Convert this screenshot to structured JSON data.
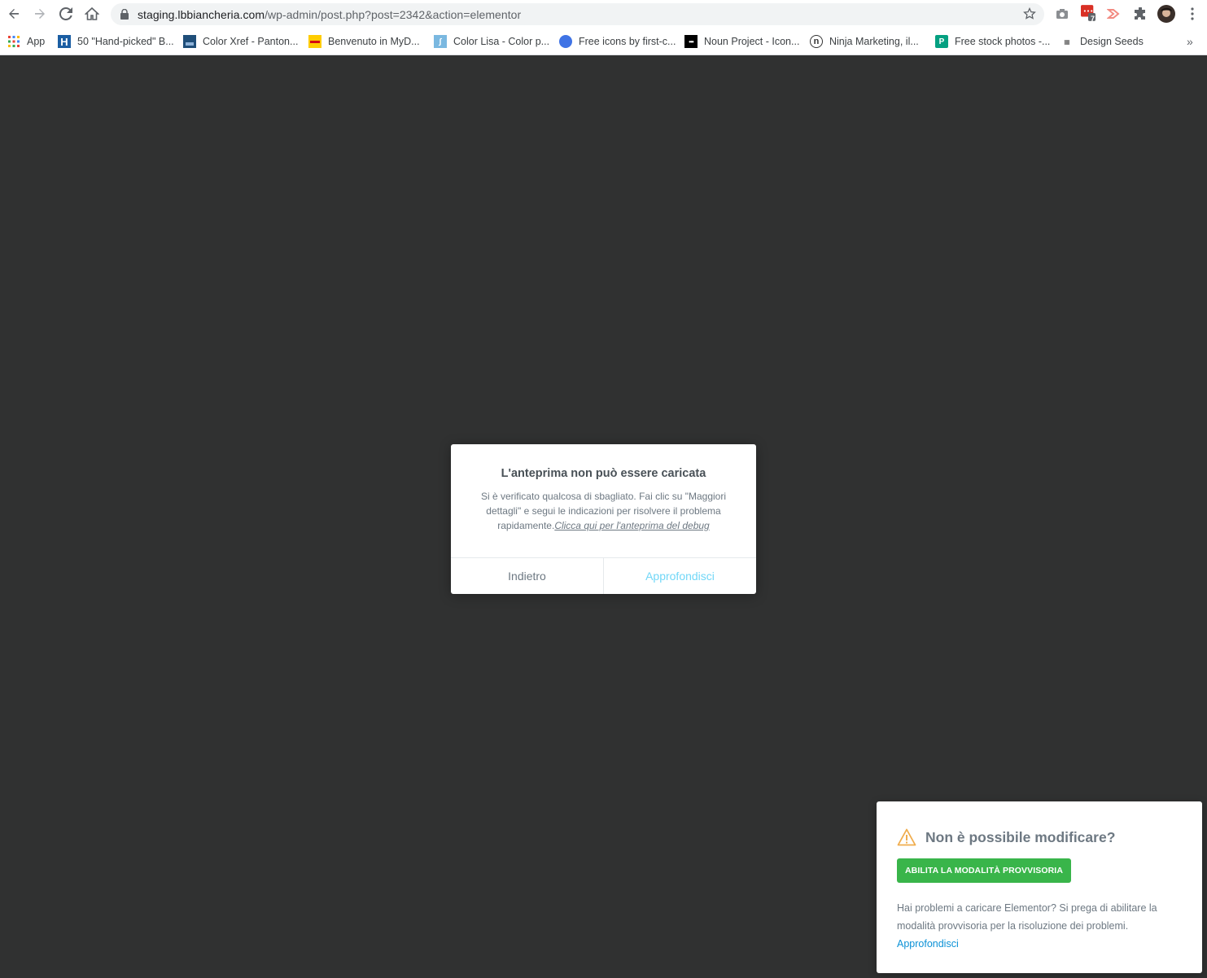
{
  "browser": {
    "url_host": "staging.lbbiancheria.com",
    "url_path": "/wp-admin/post.php?post=2342&action=elementor",
    "extension_badge": "7",
    "bookmarks": [
      {
        "label": "App",
        "icon": "apps-grid-icon"
      },
      {
        "label": "50 \"Hand-picked\" B...",
        "icon": "h-square-icon"
      },
      {
        "label": "Color Xref - Panton...",
        "icon": "pantone-icon"
      },
      {
        "label": "Benvenuto in MyD...",
        "icon": "dhl-icon"
      },
      {
        "label": "Color Lisa - Color p...",
        "icon": "colorlisa-icon"
      },
      {
        "label": "Free icons by first-c...",
        "icon": "blue-circle-icon"
      },
      {
        "label": "Noun Project - Icon...",
        "icon": "noun-project-icon"
      },
      {
        "label": "Ninja Marketing, il...",
        "icon": "ninja-icon"
      },
      {
        "label": "Free stock photos -...",
        "icon": "pexels-icon"
      },
      {
        "label": "Design Seeds",
        "icon": "design-seeds-icon"
      }
    ]
  },
  "modal": {
    "title": "L'anteprima non può essere caricata",
    "message": "Si è verificato qualcosa di sbagliato. Fai clic su \"Maggiori dettagli\" e segui le indicazioni per risolvere il problema rapidamente.",
    "debug_link": "Clicca qui per l'anteprima del debug",
    "back_label": "Indietro",
    "more_label": "Approfondisci"
  },
  "safe_mode": {
    "title": "Non è possibile modificare?",
    "button": "ABILITA LA MODALITÀ PROVVISORIA",
    "text": "Hai problemi a caricare Elementor? Si prega di abilitare la modalità provvisoria per la risoluzione dei problemi.",
    "link": "Approfondisci"
  },
  "colors": {
    "background": "#303131",
    "accent_green": "#39b54a",
    "link_blue": "#0b91d6",
    "modal_more": "#71d7f7"
  }
}
